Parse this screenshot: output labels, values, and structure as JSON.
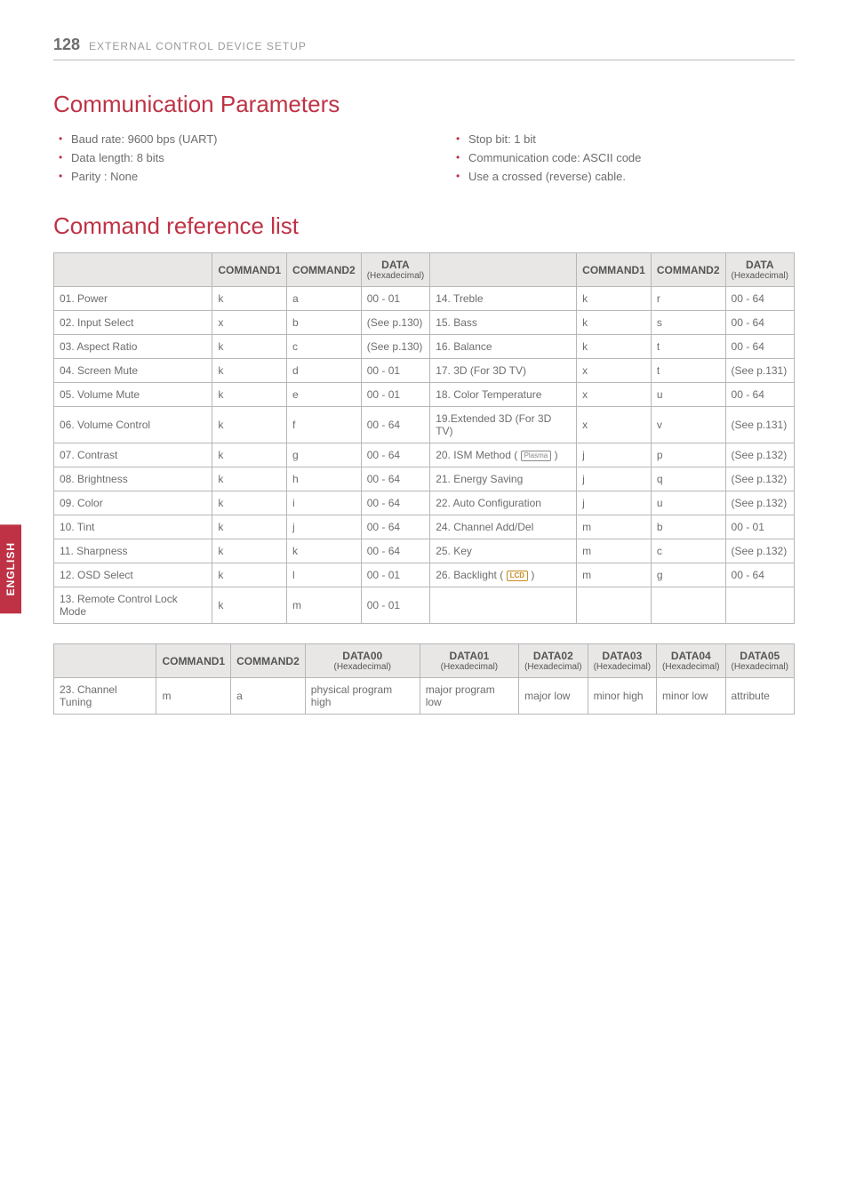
{
  "header": {
    "page_number": "128",
    "section_title": "EXTERNAL CONTROL DEVICE SETUP"
  },
  "side_tab": "ENGLISH",
  "comm_params": {
    "title": "Communication Parameters",
    "left": [
      "Baud rate: 9600 bps (UART)",
      "Data length: 8 bits",
      "Parity : None"
    ],
    "right": [
      "Stop bit: 1 bit",
      "Communication code: ASCII code",
      "Use a crossed (reverse) cable."
    ]
  },
  "cmd_ref": {
    "title": "Command reference list",
    "th": {
      "c1": "COMMAND1",
      "c2": "COMMAND2",
      "data": "DATA",
      "data_sub": "(Hexadecimal)"
    },
    "rows_left": [
      {
        "n": "01. Power",
        "a": "k",
        "b": "a",
        "d": "00 - 01"
      },
      {
        "n": "02. Input Select",
        "a": "x",
        "b": "b",
        "d": "(See p.130)"
      },
      {
        "n": "03. Aspect Ratio",
        "a": "k",
        "b": "c",
        "d": "(See p.130)"
      },
      {
        "n": "04. Screen Mute",
        "a": "k",
        "b": "d",
        "d": "00 - 01"
      },
      {
        "n": "05. Volume Mute",
        "a": "k",
        "b": "e",
        "d": "00 - 01"
      },
      {
        "n": "06. Volume Control",
        "a": "k",
        "b": "f",
        "d": "00 - 64"
      },
      {
        "n": "07. Contrast",
        "a": "k",
        "b": "g",
        "d": "00 - 64"
      },
      {
        "n": "08. Brightness",
        "a": "k",
        "b": "h",
        "d": "00 - 64"
      },
      {
        "n": "09. Color",
        "a": "k",
        "b": "i",
        "d": "00 - 64"
      },
      {
        "n": "10. Tint",
        "a": "k",
        "b": "j",
        "d": "00 - 64"
      },
      {
        "n": "11. Sharpness",
        "a": "k",
        "b": "k",
        "d": "00 - 64"
      },
      {
        "n": "12. OSD Select",
        "a": "k",
        "b": "l",
        "d": "00 - 01"
      },
      {
        "n": "13. Remote Control Lock Mode",
        "a": "k",
        "b": "m",
        "d": "00 - 01"
      }
    ],
    "rows_right": [
      {
        "n": "14. Treble",
        "a": "k",
        "b": "r",
        "d": "00 - 64"
      },
      {
        "n": "15. Bass",
        "a": "k",
        "b": "s",
        "d": "00 - 64"
      },
      {
        "n": "16. Balance",
        "a": "k",
        "b": "t",
        "d": "00 - 64"
      },
      {
        "n": "17. 3D (For 3D TV)",
        "a": "x",
        "b": "t",
        "d": "(See p.131)"
      },
      {
        "n": "18. Color Temperature",
        "a": "x",
        "b": "u",
        "d": "00 - 64"
      },
      {
        "n": "19.Extended 3D (For 3D TV)",
        "a": "x",
        "b": "v",
        "d": "(See p.131)"
      },
      {
        "n": "20. ISM Method ( ",
        "icon": "Plasma",
        "n2": " )",
        "a": "j",
        "b": "p",
        "d": "(See p.132)"
      },
      {
        "n": "21. Energy Saving",
        "a": "j",
        "b": "q",
        "d": "(See p.132)"
      },
      {
        "n": "22. Auto Configuration",
        "a": "j",
        "b": "u",
        "d": "(See p.132)"
      },
      {
        "n": "24. Channel Add/Del",
        "a": "m",
        "b": "b",
        "d": "00 - 01"
      },
      {
        "n": "25. Key",
        "a": "m",
        "b": "c",
        "d": "(See p.132)"
      },
      {
        "n": "26. Backlight ( ",
        "icon": "LCD",
        "n2": " )",
        "a": "m",
        "b": "g",
        "d": "00 - 64"
      }
    ]
  },
  "cmd_ref2": {
    "th": {
      "c1": "COMMAND1",
      "c2": "COMMAND2",
      "d0": "DATA00",
      "d1": "DATA01",
      "d2": "DATA02",
      "d3": "DATA03",
      "d4": "DATA04",
      "d5": "DATA05",
      "sub": "(Hexadecimal)"
    },
    "row": {
      "n": "23. Channel Tuning",
      "a": "m",
      "b": "a",
      "d0": "physical program high",
      "d1": "major program low",
      "d2": "major low",
      "d3": "minor high",
      "d4": "minor low",
      "d5": "attribute"
    }
  }
}
